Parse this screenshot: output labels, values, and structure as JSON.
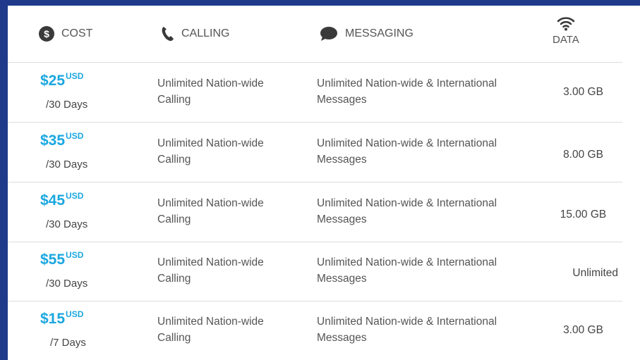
{
  "header": {
    "cost_label": "COST",
    "calling_label": "CALLING",
    "messaging_label": "MESSAGING",
    "data_label": "DATA",
    "icons": {
      "cost": "dollar-circle-icon",
      "calling": "phone-icon",
      "messaging": "chat-bubble-icon",
      "data": "wifi-icon"
    }
  },
  "colors": {
    "background": "#1f3a8a",
    "price": "#1aa7e0",
    "text": "#555555",
    "divider": "#dddddd"
  },
  "plans": [
    {
      "price": "$25",
      "currency": "USD",
      "period": "/30 Days",
      "calling_line1": "Unlimited Nation-wide",
      "calling_line2": "Calling",
      "messaging_line1": "Unlimited Nation-wide & International",
      "messaging_line2": "Messages",
      "data": "3.00 GB"
    },
    {
      "price": "$35",
      "currency": "USD",
      "period": "/30 Days",
      "calling_line1": "Unlimited Nation-wide",
      "calling_line2": "Calling",
      "messaging_line1": "Unlimited Nation-wide & International",
      "messaging_line2": "Messages",
      "data": "8.00 GB"
    },
    {
      "price": "$45",
      "currency": "USD",
      "period": "/30 Days",
      "calling_line1": "Unlimited Nation-wide",
      "calling_line2": "Calling",
      "messaging_line1": "Unlimited Nation-wide & International",
      "messaging_line2": "Messages",
      "data": "15.00 GB"
    },
    {
      "price": "$55",
      "currency": "USD",
      "period": "/30 Days",
      "calling_line1": "Unlimited Nation-wide",
      "calling_line2": "Calling",
      "messaging_line1": "Unlimited Nation-wide & International",
      "messaging_line2": "Messages",
      "data": "Unlimited"
    },
    {
      "price": "$15",
      "currency": "USD",
      "period": "/7 Days",
      "calling_line1": "Unlimited Nation-wide",
      "calling_line2": "Calling",
      "messaging_line1": "Unlimited Nation-wide & International",
      "messaging_line2": "Messages",
      "data": "3.00 GB"
    }
  ]
}
